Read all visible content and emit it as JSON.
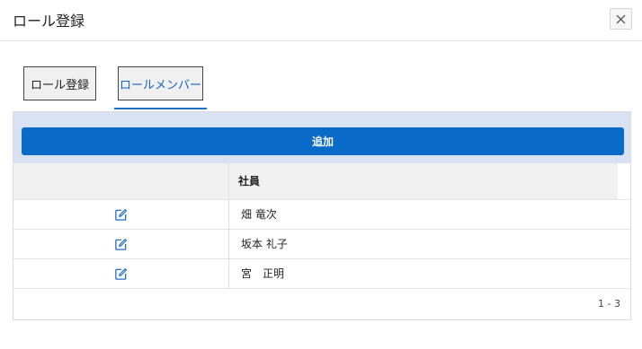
{
  "dialog": {
    "title": "ロール登録",
    "close_icon": "close-icon"
  },
  "tabs": [
    {
      "label": "ロール登録",
      "active": false
    },
    {
      "label": "ロールメンバー",
      "active": true
    }
  ],
  "toolbar": {
    "add_label": "追加"
  },
  "grid": {
    "columns": [
      "",
      "社員"
    ],
    "rows": [
      {
        "edit_icon": "edit-icon",
        "name": "畑 竜次"
      },
      {
        "edit_icon": "edit-icon",
        "name": "坂本 礼子"
      },
      {
        "edit_icon": "edit-icon",
        "name": "宮　正明"
      }
    ],
    "pager": "1 - 3"
  },
  "colors": {
    "accent": "#0a6ac8",
    "toolbar_bg": "#d9e2f2",
    "active_tab_text": "#1565c0",
    "edit_icon": "#1f6fc5"
  }
}
